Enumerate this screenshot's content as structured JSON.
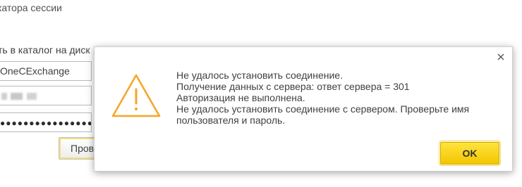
{
  "background_form": {
    "heading": "катора сессии",
    "directory_label": "ть в каталог на диск",
    "exchange_field": "OneCExchange",
    "username_field": "",
    "password_dots": "●●●●●●●●●●●●●●●●●",
    "button_label": "Пров"
  },
  "dialog": {
    "message_lines": [
      "Не удалось установить соединение.",
      "Получение данных с сервера: ответ сервера = 301",
      "Авторизация не выполнена.",
      "Не удалось установить соединение с сервером. Проверьте имя",
      "пользователя и пароль."
    ],
    "ok_label": "OK",
    "icon": "warning-triangle-icon",
    "accent_color": "#f5a623",
    "ok_color": "#f7d117"
  }
}
